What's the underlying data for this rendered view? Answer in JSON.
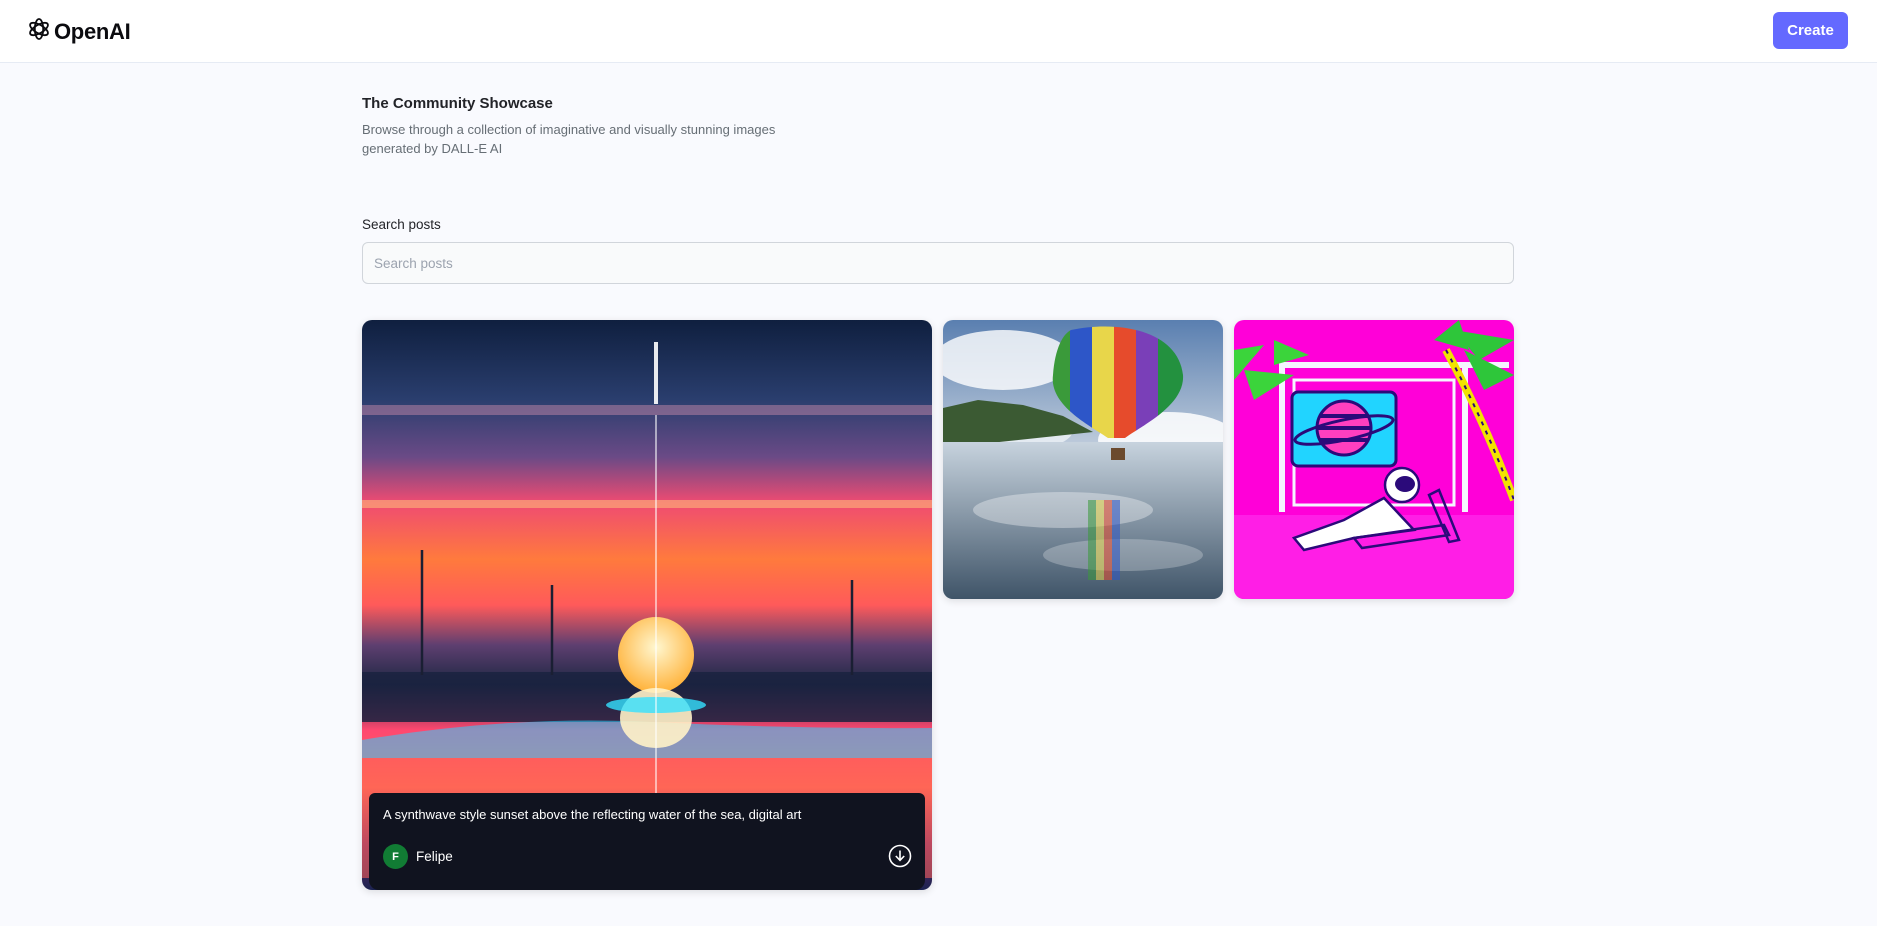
{
  "header": {
    "logo_text": "OpenAI",
    "create_label": "Create"
  },
  "hero": {
    "title": "The Community Showcase",
    "subtitle": "Browse through a collection of imaginative and visually stunning images generated by DALL-E AI"
  },
  "search": {
    "label": "Search posts",
    "placeholder": "Search posts",
    "value": ""
  },
  "posts": [
    {
      "prompt": "A synthwave style sunset above the reflecting water of the sea, digital art",
      "user": "Felipe",
      "user_initial": "F",
      "avatar_color": "#117c34"
    },
    {
      "prompt": "",
      "user": ""
    },
    {
      "prompt": "",
      "user": ""
    }
  ],
  "colors": {
    "accent": "#6469ff",
    "background": "#f9fafe",
    "caption_bg": "#10131f"
  },
  "icons": {
    "logo": "openai-logo-icon",
    "download": "download-icon"
  }
}
